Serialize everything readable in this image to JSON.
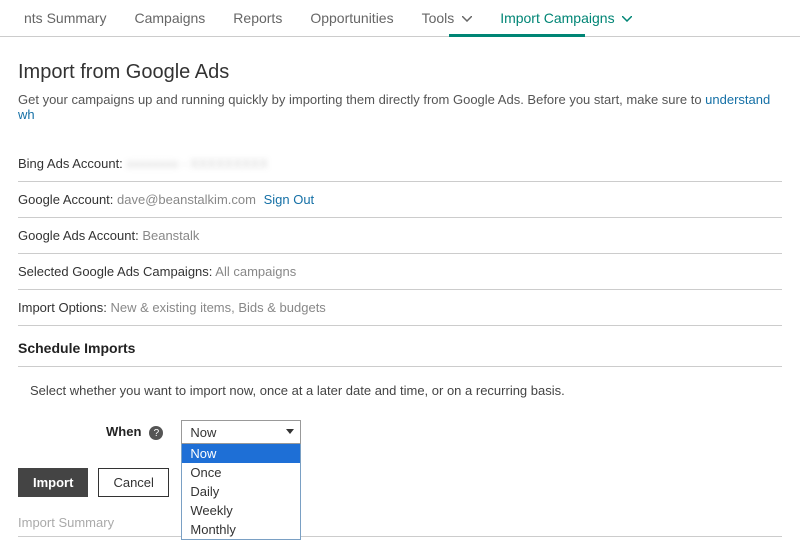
{
  "topnav": {
    "items": [
      {
        "label": "nts Summary"
      },
      {
        "label": "Campaigns"
      },
      {
        "label": "Reports"
      },
      {
        "label": "Opportunities"
      },
      {
        "label": "Tools",
        "hasChevron": true
      },
      {
        "label": "Import Campaigns",
        "hasChevron": true,
        "active": true
      }
    ]
  },
  "page": {
    "title": "Import from Google Ads",
    "intro_prefix": "Get your campaigns up and running quickly by importing them directly from Google Ads. Before you start, make sure to ",
    "intro_link": "understand wh"
  },
  "rows": {
    "bing_label": "Bing Ads Account: ",
    "bing_value": "xxxxxxxx - XXXXXXXXX",
    "google_acct_label": "Google Account: ",
    "google_acct_value": "dave@beanstalkim.com",
    "google_signout": "Sign Out",
    "google_ads_label": "Google Ads Account: ",
    "google_ads_value": "Beanstalk",
    "selected_label": "Selected Google Ads Campaigns: ",
    "selected_value": "All campaigns",
    "import_opts_label": "Import Options: ",
    "import_opts_value": "New & existing items, Bids & budgets"
  },
  "schedule": {
    "header": "Schedule Imports",
    "description": "Select whether you want to import now, once at a later date and time, or on a recurring basis.",
    "when_label": "When",
    "help_glyph": "?",
    "selected": "Now",
    "options": [
      "Now",
      "Once",
      "Daily",
      "Weekly",
      "Monthly"
    ]
  },
  "buttons": {
    "import": "Import",
    "cancel": "Cancel"
  },
  "footer": {
    "import_summary": "Import Summary"
  }
}
